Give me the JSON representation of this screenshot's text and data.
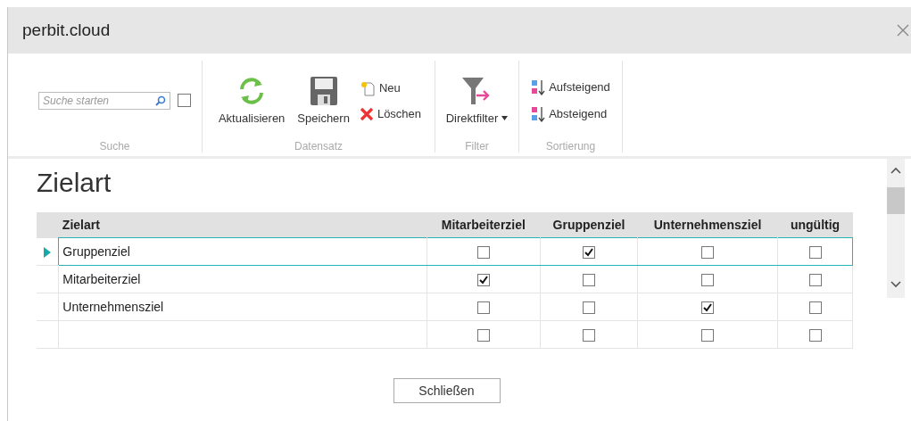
{
  "window": {
    "title": "perbit.cloud"
  },
  "ribbon": {
    "search_group": {
      "label": "Suche",
      "search": {
        "placeholder": "Suche starten"
      },
      "checkbox": {
        "checked": false
      }
    },
    "record_group": {
      "label": "Datensatz",
      "refresh": "Aktualisieren",
      "save": "Speichern",
      "new": "Neu",
      "delete": "Löschen"
    },
    "filter_group": {
      "label": "Filter",
      "direct_filter": "Direktfilter"
    },
    "sort_group": {
      "label": "Sortierung",
      "ascending": "Aufsteigend",
      "descending": "Absteigend"
    }
  },
  "page_title": "Zielart",
  "table": {
    "columns": [
      "Zielart",
      "Mitarbeiterziel",
      "Gruppenziel",
      "Unternehmensziel",
      "ungültig"
    ],
    "rows": [
      {
        "zielart": "Gruppenziel",
        "selected": true,
        "checks": [
          false,
          true,
          false,
          false
        ]
      },
      {
        "zielart": "Mitarbeiterziel",
        "selected": false,
        "checks": [
          true,
          false,
          false,
          false
        ]
      },
      {
        "zielart": "Unternehmensziel",
        "selected": false,
        "checks": [
          false,
          false,
          true,
          false
        ]
      },
      {
        "selected": false,
        "checks": [
          false,
          false,
          false,
          false
        ]
      }
    ]
  },
  "footer": {
    "close_button": "Schließen"
  }
}
